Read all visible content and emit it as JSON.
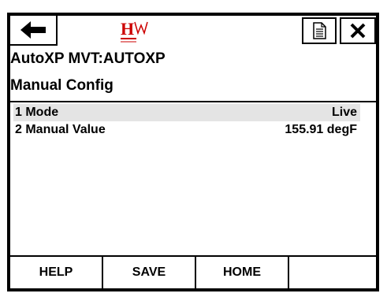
{
  "toolbar": {
    "back_icon": "arrow-left-icon",
    "logo_text": "HW",
    "document_icon": "document-icon",
    "close_icon": "close-icon"
  },
  "header": {
    "device_tag": "AutoXP MVT:AUTOXP",
    "screen_title": "Manual Config"
  },
  "menu": {
    "items": [
      {
        "label": "1 Mode",
        "value": "Live"
      },
      {
        "label": "2 Manual Value",
        "value": "155.91 degF"
      }
    ]
  },
  "footer": {
    "help_label": "HELP",
    "save_label": "SAVE",
    "home_label": "HOME"
  },
  "colors": {
    "logo_red": "#cc0000",
    "selected_row": "#e4e4e4",
    "border": "#000000"
  }
}
